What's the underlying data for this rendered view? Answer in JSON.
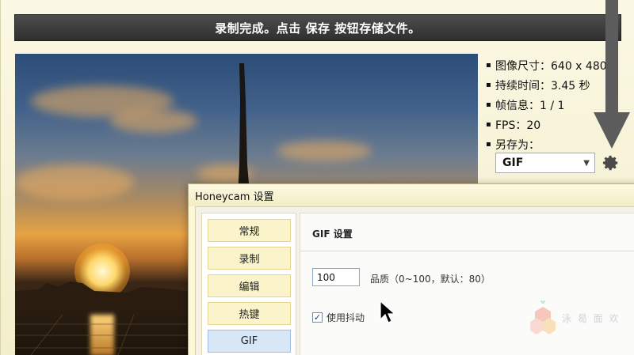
{
  "banner": {
    "message": "录制完成。点击 保存 按钮存储文件。"
  },
  "info": {
    "rows": [
      {
        "label": "图像尺寸：640 x 480"
      },
      {
        "label": "持续时间：3.45 秒"
      },
      {
        "label": "帧信息：1 / 1"
      },
      {
        "label": "FPS：20"
      },
      {
        "label": "另存为："
      }
    ],
    "save_format": "GIF"
  },
  "icons": {
    "gear": "gear-icon",
    "arrow": "down-arrow-icon",
    "dropdown": "chevron-down-icon",
    "cursor": "mouse-pointer-icon",
    "checkbox_mark": "✓"
  },
  "dialog": {
    "title": "Honeycam 设置",
    "nav": [
      "常规",
      "录制",
      "编辑",
      "热键",
      "GIF"
    ],
    "active_nav": "GIF",
    "section_title": "GIF 设置",
    "quality_value": "100",
    "quality_label": "品质（0~100，默认：80）",
    "dither_label": "使用抖动",
    "dither_checked": true
  },
  "watermark": {
    "text": "泳 曷 面 欢"
  },
  "colors": {
    "banner": "#3a3a3a",
    "nav_active": "#d7e7f7",
    "nav_item": "#fbf3c9",
    "frame": "#f6f2d4"
  }
}
